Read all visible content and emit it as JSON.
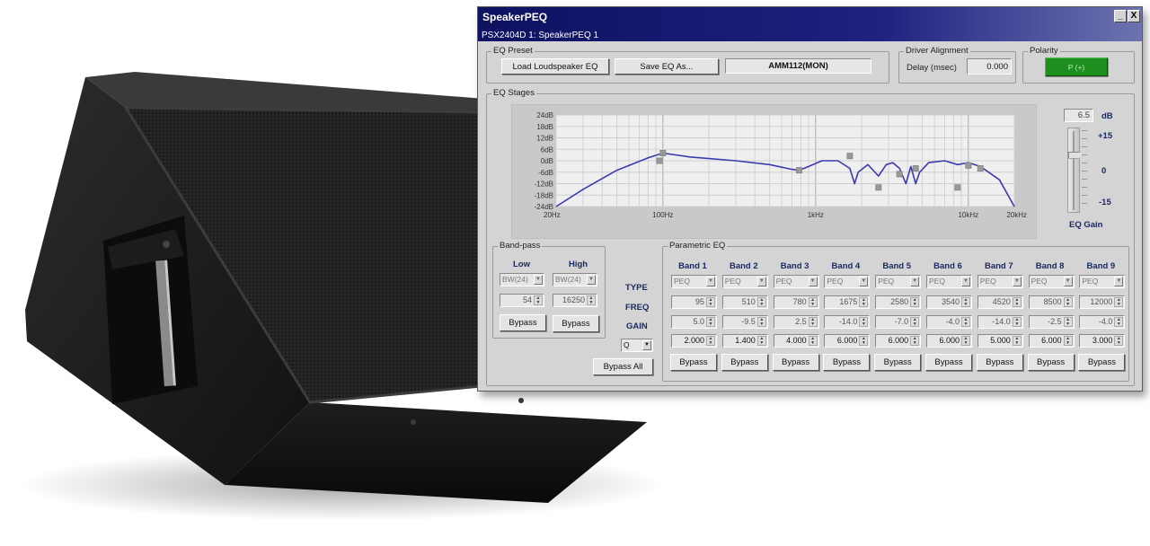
{
  "window": {
    "title": "SpeakerPEQ",
    "subtitle": "PSX2404D 1: SpeakerPEQ 1",
    "minimize": "_",
    "close": "X"
  },
  "eq_preset": {
    "label": "EQ Preset",
    "load_label": "Load Loudspeaker EQ",
    "save_label": "Save EQ As...",
    "preset_name": "AMM112(MON)"
  },
  "driver_alignment": {
    "label": "Driver Alignment",
    "delay_label": "Delay (msec)",
    "delay_value": "0.000"
  },
  "polarity": {
    "label": "Polarity",
    "value": "P (+)"
  },
  "eq_stages": {
    "label": "EQ Stages",
    "y_ticks": [
      "24dB",
      "18dB",
      "12dB",
      "6dB",
      "0dB",
      "-6dB",
      "-12dB",
      "-18dB",
      "-24dB"
    ],
    "x_ticks": [
      "20Hz",
      "100Hz",
      "1kHz",
      "10kHz",
      "20kHz"
    ],
    "curve": [
      [
        20,
        -24
      ],
      [
        30,
        -15
      ],
      [
        50,
        -5
      ],
      [
        80,
        1.5
      ],
      [
        100,
        4
      ],
      [
        150,
        2
      ],
      [
        300,
        0
      ],
      [
        500,
        -2
      ],
      [
        700,
        -4.5
      ],
      [
        780,
        -5
      ],
      [
        900,
        -3
      ],
      [
        1100,
        0
      ],
      [
        1400,
        0
      ],
      [
        1675,
        -4
      ],
      [
        1800,
        -12
      ],
      [
        1900,
        -6
      ],
      [
        2200,
        -2
      ],
      [
        2580,
        -8
      ],
      [
        2900,
        -2
      ],
      [
        3200,
        -1
      ],
      [
        3540,
        -4
      ],
      [
        3900,
        -12
      ],
      [
        4200,
        -3
      ],
      [
        4520,
        -12
      ],
      [
        4800,
        -6
      ],
      [
        5500,
        -1
      ],
      [
        7000,
        0
      ],
      [
        8500,
        -2
      ],
      [
        10000,
        -1
      ],
      [
        12000,
        -3
      ],
      [
        16000,
        -10
      ],
      [
        20000,
        -24
      ]
    ],
    "handles": [
      [
        95,
        0
      ],
      [
        100,
        4
      ],
      [
        780,
        -5
      ],
      [
        1675,
        2.5
      ],
      [
        2580,
        -14
      ],
      [
        3540,
        -7
      ],
      [
        4520,
        -4
      ],
      [
        8500,
        -14
      ],
      [
        10000,
        -2.5
      ],
      [
        12000,
        -4
      ]
    ]
  },
  "eq_gain": {
    "value": "6.5",
    "unit": "dB",
    "max_label": "+15",
    "mid_label": "0",
    "min_label": "-15",
    "label": "EQ Gain",
    "level_db": 6.5
  },
  "bandpass": {
    "label": "Band-pass",
    "low_label": "Low",
    "high_label": "High",
    "low_type": "BW(24)",
    "high_type": "BW(24)",
    "low_freq": "54",
    "high_freq": "16250",
    "low_bypass": "Bypass",
    "high_bypass": "Bypass"
  },
  "row_labels": {
    "type": "TYPE",
    "freq": "FREQ",
    "gain": "GAIN",
    "q_select": "Q",
    "bypass_all": "Bypass All"
  },
  "parametric": {
    "label": "Parametric EQ",
    "bands": [
      {
        "name": "Band 1",
        "type": "PEQ",
        "freq": "95",
        "gain": "5.0",
        "q": "2.000",
        "bypass": "Bypass"
      },
      {
        "name": "Band 2",
        "type": "PEQ",
        "freq": "510",
        "gain": "-9.5",
        "q": "1.400",
        "bypass": "Bypass"
      },
      {
        "name": "Band 3",
        "type": "PEQ",
        "freq": "780",
        "gain": "2.5",
        "q": "4.000",
        "bypass": "Bypass"
      },
      {
        "name": "Band 4",
        "type": "PEQ",
        "freq": "1675",
        "gain": "-14.0",
        "q": "6.000",
        "bypass": "Bypass"
      },
      {
        "name": "Band 5",
        "type": "PEQ",
        "freq": "2580",
        "gain": "-7.0",
        "q": "6.000",
        "bypass": "Bypass"
      },
      {
        "name": "Band 6",
        "type": "PEQ",
        "freq": "3540",
        "gain": "-4.0",
        "q": "6.000",
        "bypass": "Bypass"
      },
      {
        "name": "Band 7",
        "type": "PEQ",
        "freq": "4520",
        "gain": "-14.0",
        "q": "5.000",
        "bypass": "Bypass"
      },
      {
        "name": "Band 8",
        "type": "PEQ",
        "freq": "8500",
        "gain": "-2.5",
        "q": "6.000",
        "bypass": "Bypass"
      },
      {
        "name": "Band 9",
        "type": "PEQ",
        "freq": "12000",
        "gain": "-4.0",
        "q": "3.000",
        "bypass": "Bypass"
      }
    ]
  },
  "colors": {
    "title_bar": "#0e1260",
    "polarity_on": "#1e8f1e",
    "curve": "#3a3ab0",
    "band_label": "#1a2a60"
  }
}
